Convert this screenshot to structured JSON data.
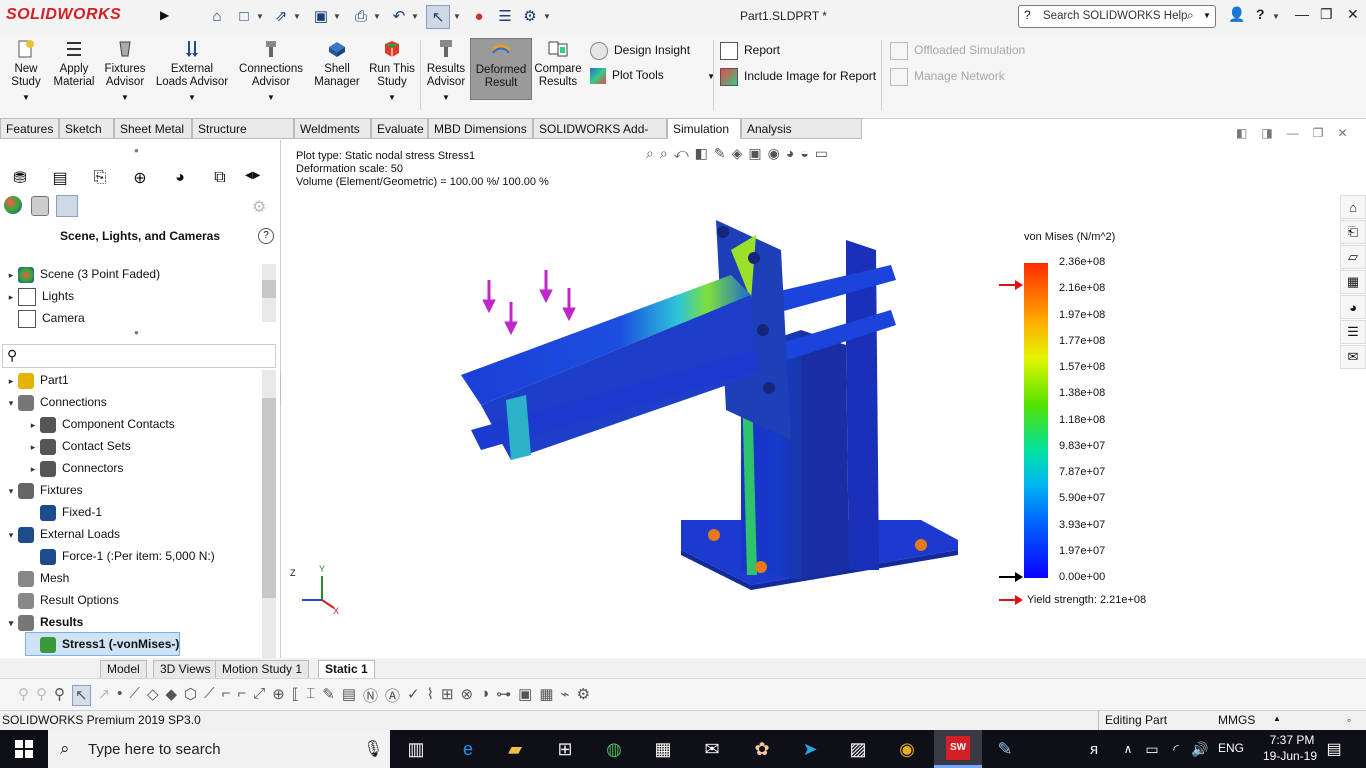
{
  "app": {
    "brand": "SOLIDWORKS",
    "document_title": "Part1.SLDPRT *"
  },
  "help_search": {
    "placeholder": "Search SOLIDWORKS Help"
  },
  "ribbon": {
    "new_study": "New Study",
    "apply_material": "Apply Material",
    "fixtures_advisor": "Fixtures Advisor",
    "external_loads_advisor": "External Loads Advisor",
    "connections_advisor": "Connections Advisor",
    "shell_manager": "Shell Manager",
    "run_this_study": "Run This Study",
    "results_advisor": "Results Advisor",
    "deformed_result": "Deformed Result",
    "compare_results": "Compare Results",
    "design_insight": "Design Insight",
    "plot_tools": "Plot Tools",
    "report": "Report",
    "include_image_for_report": "Include Image for Report",
    "offloaded_simulation": "Offloaded Simulation",
    "manage_network": "Manage Network"
  },
  "command_tabs": [
    "Features",
    "Sketch",
    "Sheet Metal",
    "Structure System",
    "Weldments",
    "Evaluate",
    "MBD Dimensions",
    "SOLIDWORKS Add-Ins",
    "Simulation",
    "Analysis Preparation"
  ],
  "active_command_tab": "Simulation",
  "left_panel": {
    "section_title": "Scene, Lights, and Cameras",
    "scene_items": [
      "Scene (3 Point Faded)",
      "Lights",
      "Camera"
    ],
    "tree": [
      {
        "label": "Part1",
        "level": 0,
        "arrow": "▸"
      },
      {
        "label": "Connections",
        "level": 0,
        "arrow": "▾"
      },
      {
        "label": "Component Contacts",
        "level": 1,
        "arrow": "▸"
      },
      {
        "label": "Contact Sets",
        "level": 1,
        "arrow": "▸"
      },
      {
        "label": "Connectors",
        "level": 1,
        "arrow": "▸"
      },
      {
        "label": "Fixtures",
        "level": 0,
        "arrow": "▾"
      },
      {
        "label": "Fixed-1",
        "level": 1,
        "arrow": ""
      },
      {
        "label": "External Loads",
        "level": 0,
        "arrow": "▾"
      },
      {
        "label": "Force-1 (:Per item: 5,000 N:)",
        "level": 1,
        "arrow": ""
      },
      {
        "label": "Mesh",
        "level": 0,
        "arrow": ""
      },
      {
        "label": "Result Options",
        "level": 0,
        "arrow": ""
      },
      {
        "label": "Results",
        "level": 0,
        "arrow": "▾"
      },
      {
        "label": "Stress1 (-vonMises-)",
        "level": 1,
        "arrow": ""
      }
    ]
  },
  "viewport": {
    "info_lines": [
      "Plot type: Static nodal stress Stress1",
      "Deformation scale: 50",
      "Volume (Element/Geometric) = 100.00 %/ 100.00 %"
    ],
    "legend": {
      "title": "von Mises (N/m^2)",
      "ticks": [
        "2.36e+08",
        "2.16e+08",
        "1.97e+08",
        "1.77e+08",
        "1.57e+08",
        "1.38e+08",
        "1.18e+08",
        "9.83e+07",
        "7.87e+07",
        "5.90e+07",
        "3.93e+07",
        "1.97e+07",
        "0.00e+00"
      ],
      "yield_label": "Yield strength: 2.21e+08"
    },
    "triad": {
      "x": "X",
      "y": "Y",
      "z": "Z"
    }
  },
  "bottom_tabs": [
    "Model",
    "3D Views",
    "Motion Study 1",
    "Static 1"
  ],
  "active_bottom_tab": "Static 1",
  "status_bar": {
    "product": "SOLIDWORKS Premium 2019 SP3.0",
    "mode": "Editing Part",
    "units": "MMGS"
  },
  "taskbar": {
    "search_placeholder": "Type here to search",
    "language": "ENG",
    "time": "7:37 PM",
    "date": "19-Jun-19"
  }
}
